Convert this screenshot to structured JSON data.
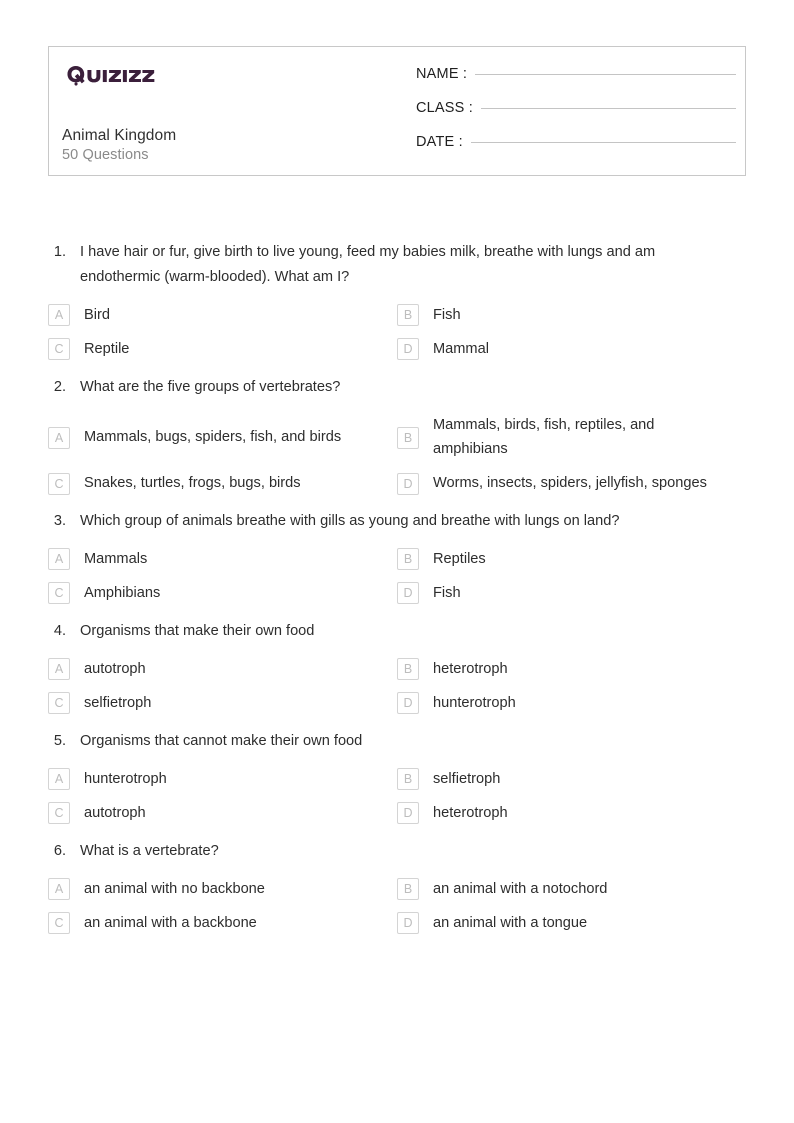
{
  "brand": {
    "logo_text": "Quizizz",
    "logo_color": "#3B1F3B"
  },
  "header": {
    "quiz_title": "Animal Kingdom",
    "question_count_label": "50 Questions",
    "fields": [
      {
        "label": "NAME :"
      },
      {
        "label": "CLASS :"
      },
      {
        "label": "DATE  :"
      }
    ]
  },
  "questions": [
    {
      "number": "1.",
      "text": "I have hair or fur, give birth to live young, feed my babies milk, breathe with lungs and am endothermic (warm-blooded). What am I?",
      "options": [
        {
          "letter": "A",
          "text": "Bird"
        },
        {
          "letter": "B",
          "text": "Fish"
        },
        {
          "letter": "C",
          "text": "Reptile"
        },
        {
          "letter": "D",
          "text": "Mammal"
        }
      ]
    },
    {
      "number": "2.",
      "text": "What are the five groups of vertebrates?",
      "options": [
        {
          "letter": "A",
          "text": "Mammals, bugs, spiders, fish, and birds"
        },
        {
          "letter": "B",
          "text": "Mammals, birds, fish, reptiles, and amphibians"
        },
        {
          "letter": "C",
          "text": "Snakes, turtles, frogs, bugs, birds"
        },
        {
          "letter": "D",
          "text": "Worms, insects, spiders, jellyfish, sponges"
        }
      ]
    },
    {
      "number": "3.",
      "text": "Which group of animals breathe with gills as young and breathe with lungs on land?",
      "options": [
        {
          "letter": "A",
          "text": "Mammals"
        },
        {
          "letter": "B",
          "text": "Reptiles"
        },
        {
          "letter": "C",
          "text": "Amphibians"
        },
        {
          "letter": "D",
          "text": "Fish"
        }
      ]
    },
    {
      "number": "4.",
      "text": "Organisms that make their own food",
      "options": [
        {
          "letter": "A",
          "text": "autotroph"
        },
        {
          "letter": "B",
          "text": "heterotroph"
        },
        {
          "letter": "C",
          "text": "selfietroph"
        },
        {
          "letter": "D",
          "text": "hunterotroph"
        }
      ]
    },
    {
      "number": "5.",
      "text": "Organisms that cannot make their own food",
      "options": [
        {
          "letter": "A",
          "text": "hunterotroph"
        },
        {
          "letter": "B",
          "text": "selfietroph"
        },
        {
          "letter": "C",
          "text": "autotroph"
        },
        {
          "letter": "D",
          "text": "heterotroph"
        }
      ]
    },
    {
      "number": "6.",
      "text": "What is a vertebrate?",
      "options": [
        {
          "letter": "A",
          "text": "an animal with no backbone"
        },
        {
          "letter": "B",
          "text": "an animal with a notochord"
        },
        {
          "letter": "C",
          "text": "an animal with a backbone"
        },
        {
          "letter": "D",
          "text": "an animal with a tongue"
        }
      ]
    }
  ]
}
